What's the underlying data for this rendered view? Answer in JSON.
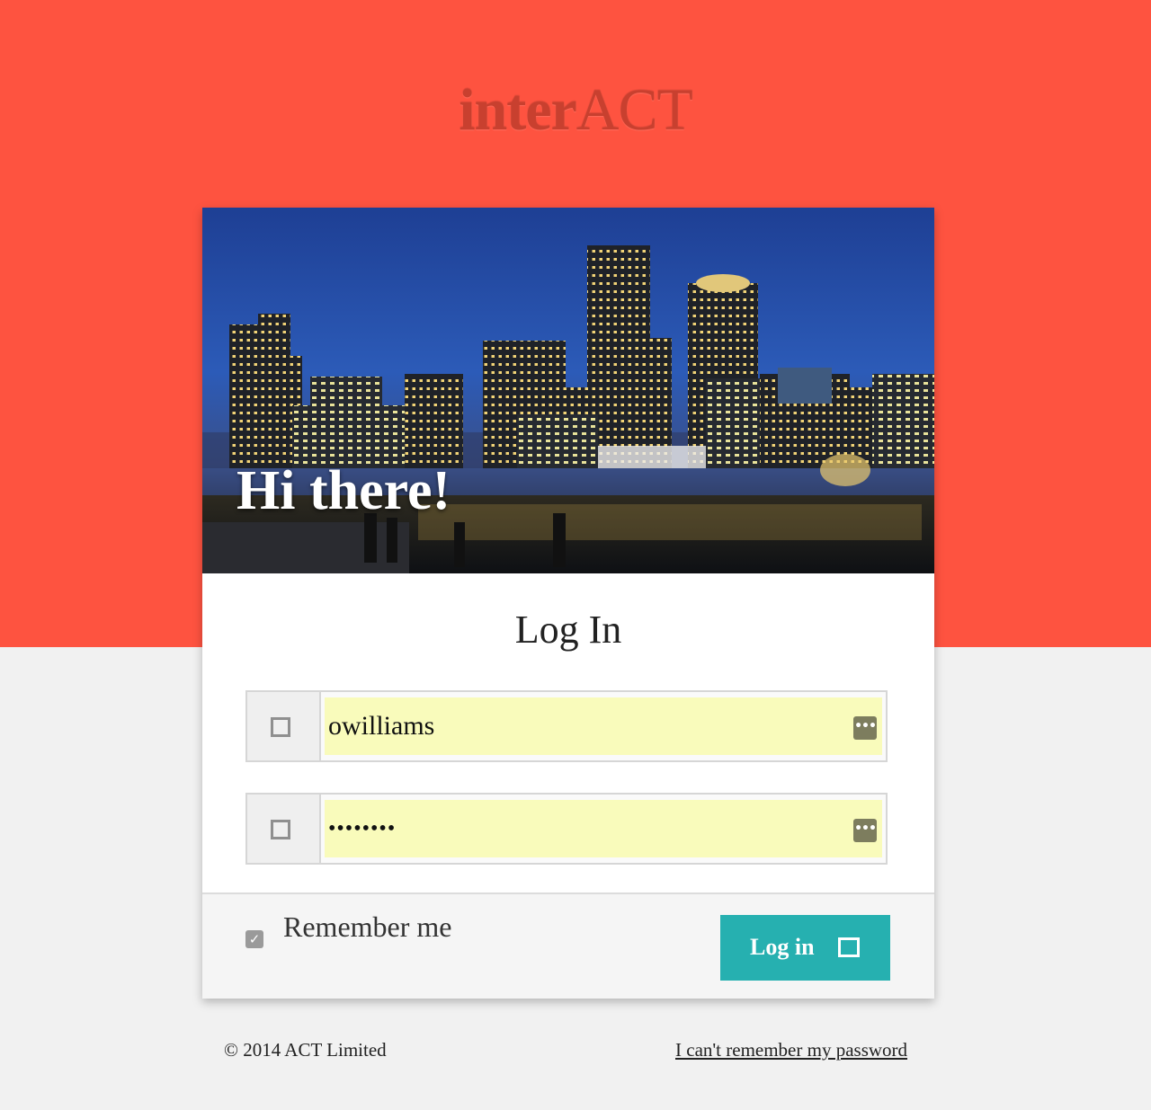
{
  "brand": {
    "part1": "inter",
    "part2": "ACT"
  },
  "hero": {
    "title": "Hi there!",
    "image": "city-skyline-at-night"
  },
  "form": {
    "heading": "Log In",
    "username": {
      "value": "owilliams",
      "icon": "user-icon",
      "trailing_icon": "password-manager-icon"
    },
    "password": {
      "value": "••••••••",
      "icon": "lock-icon",
      "trailing_icon": "password-manager-icon"
    },
    "remember": {
      "label": "Remember me",
      "checked": true
    },
    "submit": {
      "label": "Log in",
      "icon": "sign-in-icon"
    }
  },
  "footer": {
    "copyright": "© 2014 ACT Limited",
    "forgot_link": "I can't remember my password"
  },
  "colors": {
    "top_band": "#fe5340",
    "brand_text": "#c8402f",
    "background": "#f1f1f1",
    "accent": "#26b0b0",
    "autofill": "#f9fbbb"
  }
}
